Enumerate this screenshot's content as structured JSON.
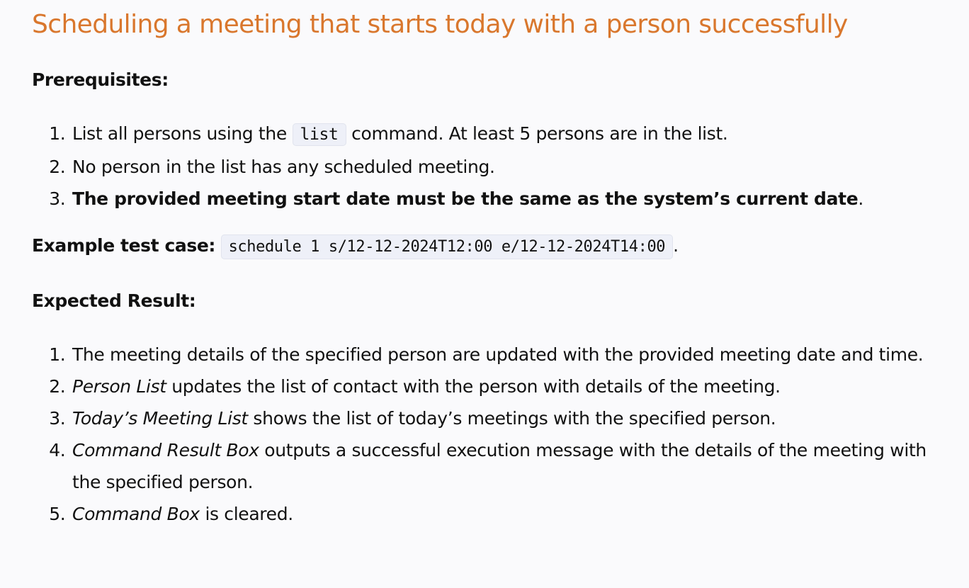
{
  "title": "Scheduling a meeting that starts today with a person successfully",
  "prerequisites": {
    "heading": "Prerequisites:",
    "item1_before": "List all persons using the",
    "item1_code": "list",
    "item1_after": "command. At least 5 persons are in the list.",
    "item2": "No person in the list has any scheduled meeting.",
    "item3_bold": "The provided meeting start date must be the same as the system’s current date",
    "item3_after": "."
  },
  "example": {
    "label": "Example test case:",
    "code": "schedule 1 s/12-12-2024T12:00 e/12-12-2024T14:00",
    "after": "."
  },
  "expected": {
    "heading": "Expected Result:",
    "item1": "The meeting details of the specified person are updated with the provided meeting date and time.",
    "item2_italic": "Person List",
    "item2_rest": " updates the list of contact with the person with details of the meeting.",
    "item3_italic": "Today’s Meeting List",
    "item3_rest": " shows the list of today’s meetings with the specified person.",
    "item4_italic": "Command Result Box",
    "item4_rest": " outputs a successful execution message with the details of the meeting with the specified person.",
    "item5_italic": "Command Box",
    "item5_rest": " is cleared."
  }
}
